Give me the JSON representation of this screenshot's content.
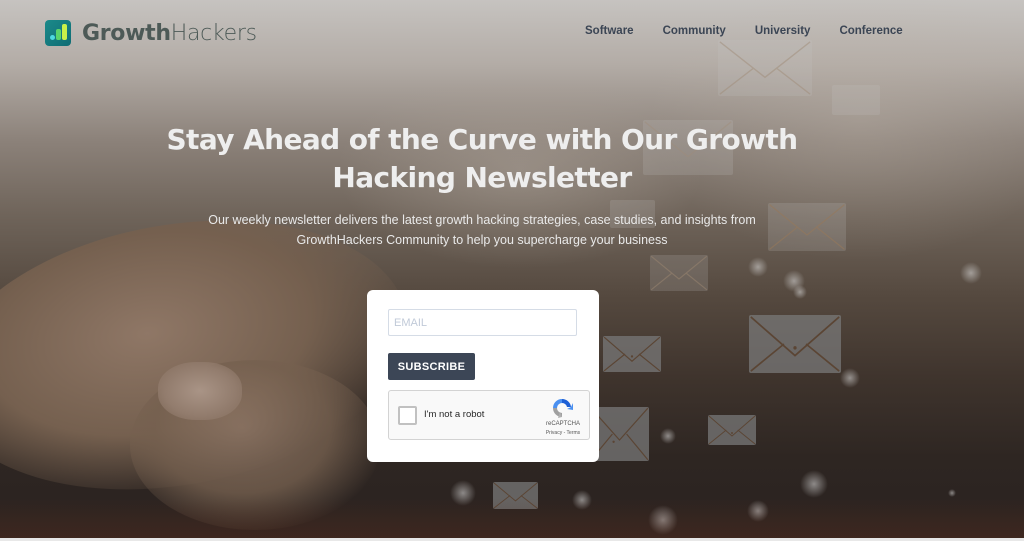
{
  "brand": {
    "name_bold": "Growth",
    "name_light": "Hackers",
    "colors": {
      "logo_bg": "#127a80",
      "bar_dot": "#4dd9e0",
      "bar_mid": "#5bd46b",
      "bar_tall": "#c8f04a",
      "text": "#4d5a57"
    }
  },
  "nav": {
    "items": [
      {
        "label": "Software"
      },
      {
        "label": "Community"
      },
      {
        "label": "University"
      },
      {
        "label": "Conference"
      }
    ]
  },
  "hero": {
    "headline_line1": "Stay Ahead of the Curve with Our Growth",
    "headline_line2": "Hacking Newsletter",
    "subtext_line1": "Our weekly newsletter delivers the latest growth hacking strategies, case studies, and insights from",
    "subtext_line2": "GrowthHackers Community to help you supercharge your business"
  },
  "form": {
    "email_value": "",
    "email_placeholder": "EMAIL",
    "subscribe_label": "SUBSCRIBE",
    "button_color": "#3c4656",
    "captcha": {
      "checkbox_label": "I'm not a robot",
      "checked": false,
      "brand": "reCAPTCHA",
      "links": "Privacy - Terms"
    }
  }
}
